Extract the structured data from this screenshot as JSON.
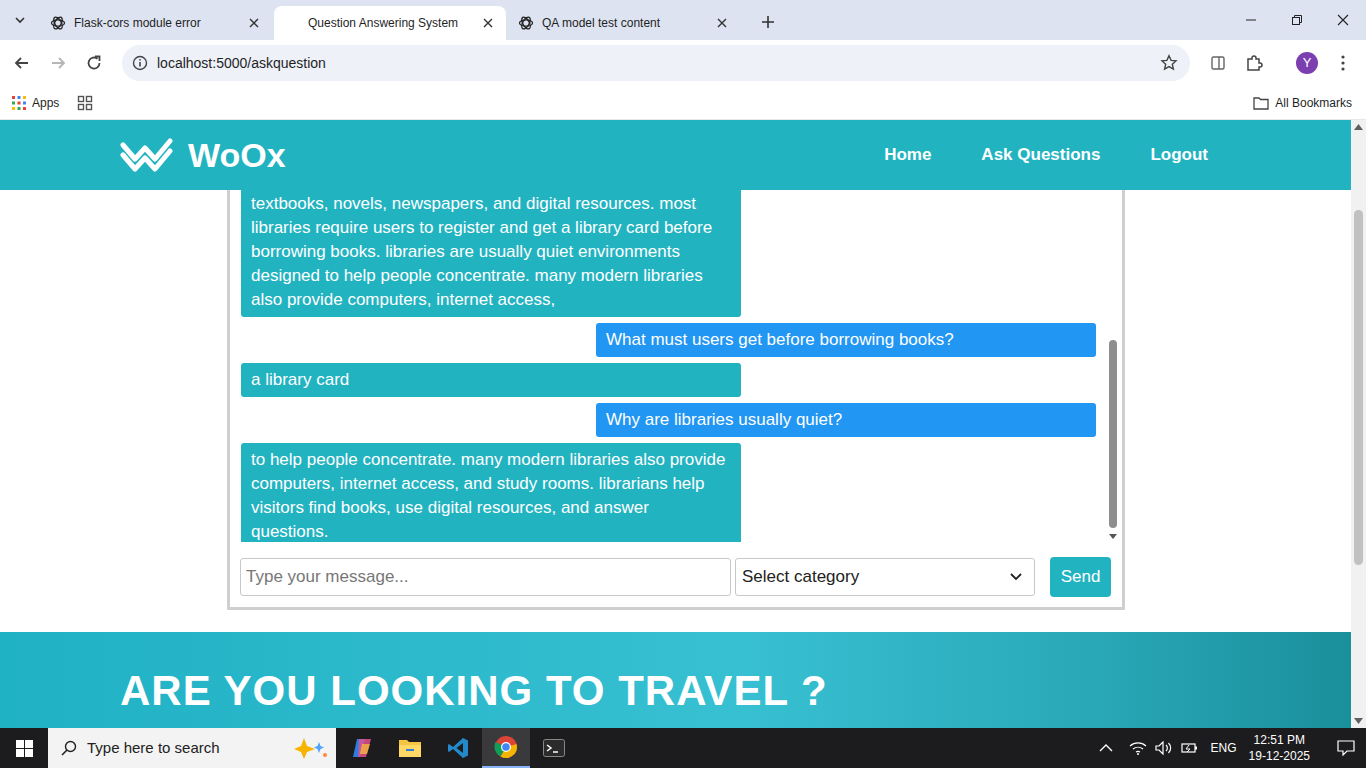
{
  "browser": {
    "tabs": [
      {
        "label": "Flask-cors module error",
        "selected": false,
        "kind": "chatgpt"
      },
      {
        "label": "Question Answering System",
        "selected": true,
        "kind": "site"
      },
      {
        "label": "QA model test content",
        "selected": false,
        "kind": "chatgpt"
      }
    ],
    "forward": {
      "disabled": true
    },
    "url": "localhost:5000/askquestion",
    "profile": "Y",
    "bookmarks": [
      "Apps"
    ],
    "all_bookmarks": "All Bookmarks"
  },
  "site": {
    "logo": "WoOx",
    "nav": [
      "Home",
      "Ask Questions",
      "Logout"
    ]
  },
  "chat": {
    "messages": [
      {
        "kind": "bot",
        "text": "textbooks, novels, newspapers, and digital resources. most libraries require users to register and get a library card before borrowing books. libraries are usually quiet environments designed to help people concentrate. many modern libraries also provide computers, internet access,"
      },
      {
        "kind": "user",
        "text": "What must users get before borrowing books?"
      },
      {
        "kind": "bot",
        "text": "a library card"
      },
      {
        "kind": "user",
        "text": "Why are libraries usually quiet?"
      },
      {
        "kind": "bot",
        "text": "to help people concentrate. many modern libraries also provide computers, internet access, and study rooms. librarians help visitors find books, use digital resources, and answer questions."
      }
    ],
    "input": {
      "placeholder": "Type your message..."
    },
    "category": "Select category",
    "send": "Send"
  },
  "banner": {
    "title": "ARE YOU LOOKING TO TRAVEL ?"
  },
  "taskbar": {
    "search": {
      "placeholder": "Type here to search"
    },
    "language": "ENG",
    "time": "12:51 PM",
    "date": "19-12-2025"
  }
}
